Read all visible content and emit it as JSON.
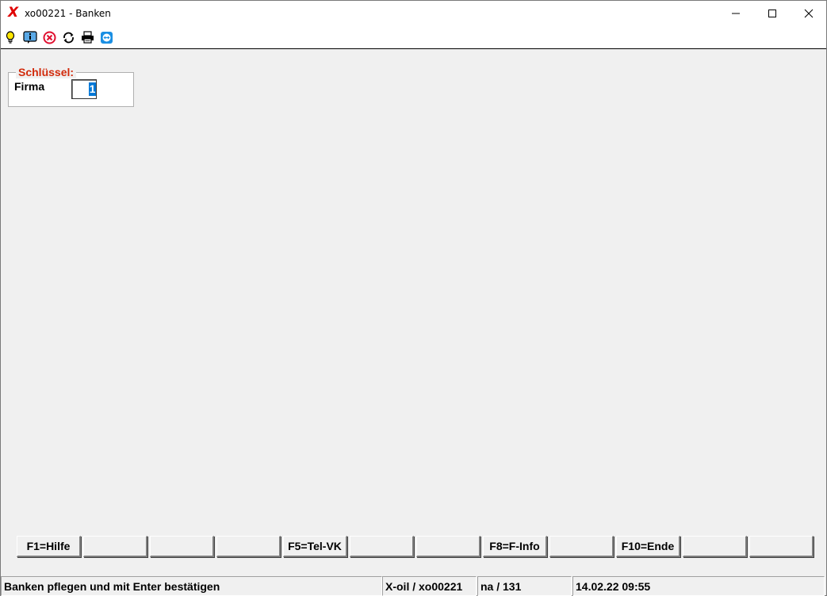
{
  "window": {
    "logo": "X",
    "title": "xo00221 - Banken",
    "controls": {
      "minimize_icon": "minimize-icon",
      "maximize_icon": "maximize-icon",
      "close_icon": "close-icon"
    }
  },
  "toolbar": {
    "icons": [
      "lightbulb-icon",
      "info-icon",
      "cancel-icon",
      "refresh-icon",
      "printer-icon",
      "remote-support-icon"
    ]
  },
  "key_group": {
    "legend": "Schlüssel:",
    "firma_label": "Firma",
    "firma_value": "1"
  },
  "function_keys": [
    "F1=Hilfe",
    "",
    "",
    "",
    "F5=Tel-VK",
    "",
    "",
    "F8=F-Info",
    "",
    "F10=Ende",
    "",
    ""
  ],
  "statusbar": {
    "message": "Banken pflegen und mit Enter bestätigen",
    "program": "X-oil / xo00221",
    "user": "na / 131",
    "datetime": "14.02.22 09:55"
  },
  "colors": {
    "legend": "#d22b0c",
    "logo": "#e00000",
    "selection": "#0078d7",
    "background": "#f0f0f0"
  }
}
